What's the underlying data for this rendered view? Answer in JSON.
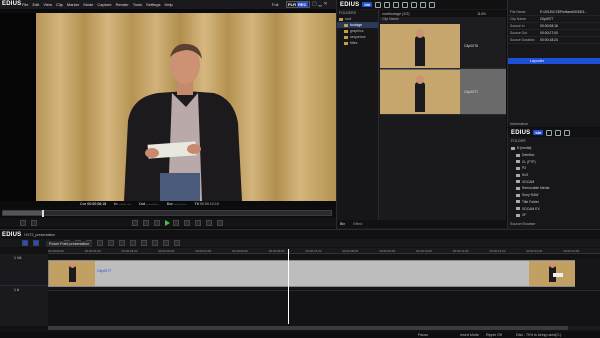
{
  "menu": {
    "logo": "EDIUS",
    "items": [
      "File",
      "Edit",
      "View",
      "Clip",
      "Marker",
      "Mode",
      "Capture",
      "Render",
      "Tools",
      "Settings",
      "Help"
    ],
    "center": "Full",
    "plr": "PLR",
    "rec": "REC"
  },
  "preview": {
    "cue_label": "Cur",
    "cue_value": "00:00:08;18",
    "in_label": "In",
    "in_value": "--:--:--:--",
    "out_label": "Out",
    "out_value": "--:--:--:--",
    "dur_label": "Dur",
    "dur_value": "--:--:--:--",
    "ttl_label": "Ttl",
    "ttl_value": "00:00:12;10"
  },
  "bin": {
    "logo": "EDIUS",
    "bin_tag": "bin",
    "folders_label": "FOLDERS",
    "tree": [
      {
        "label": "root",
        "level": 0
      },
      {
        "label": "footage",
        "level": 1,
        "selected": true
      },
      {
        "label": "graphics",
        "level": 1
      },
      {
        "label": "sequence",
        "level": 1
      },
      {
        "label": "titles",
        "level": 1
      }
    ],
    "path": "root/footage (2/2)",
    "clip_name_col": "Clip Name",
    "zoom": "114%",
    "clips": [
      {
        "name": "Clip0076",
        "selected": false
      },
      {
        "name": "Clip0077",
        "selected": true
      }
    ],
    "bottom_left": "Bin",
    "bottom_right": "Effect"
  },
  "props": {
    "rows": [
      {
        "k": "File Name",
        "v": "E:\\2015\\3 23\\Portland\\2015\\3..."
      },
      {
        "k": "Clip Name",
        "v": "Clip0077"
      },
      {
        "k": "Source In",
        "v": "00:00:08;16"
      },
      {
        "k": "Source Out",
        "v": "00:00:27;00"
      },
      {
        "k": "Source Duration",
        "v": "00:00:18;24"
      }
    ],
    "layouter": "Layouter",
    "information": "Information"
  },
  "source_browser": {
    "logo": "EDIUS",
    "bin_tag": "bin",
    "folder_label": "FOLDER",
    "items": [
      "E:[media]",
      "Deletion",
      "XL (FTP)",
      "P2",
      "SxS",
      "XDCAM",
      "Removable Media",
      "Sony RAW",
      "Title Folder",
      "XDCAM EX",
      "XF"
    ],
    "footer": "Source Browser"
  },
  "timeline": {
    "logo": "EDIUS",
    "project": "HXT2_presentation",
    "seq_tab": "Power Point presentation",
    "ruler": [
      "00:00:00;00",
      "00:00:01;00",
      "00:00:02;00",
      "00:00:03;00",
      "00:00:04;00",
      "00:00:05;00",
      "00:00:06;00",
      "00:00:07;00",
      "00:00:08;00",
      "00:00:09;00",
      "00:00:10;00",
      "00:00:11;00",
      "00:00:12;00",
      "00:00:13;00",
      "00:00:14;00"
    ],
    "tracks": [
      {
        "name": "1 VA",
        "type": "video"
      },
      {
        "name": "1 A",
        "type": "audio"
      }
    ],
    "clip_label": "Clip0077",
    "status": {
      "pause": "Pause",
      "insert": "Insert Mode",
      "ripple": "Ripple Off",
      "disk": "Disk : 70% is being used(C:)"
    }
  },
  "colors": {
    "accent": "#1f4fd6",
    "play": "#48c040",
    "timeline_clip": "#bdbdbd",
    "backdrop": "#c9a76a"
  }
}
